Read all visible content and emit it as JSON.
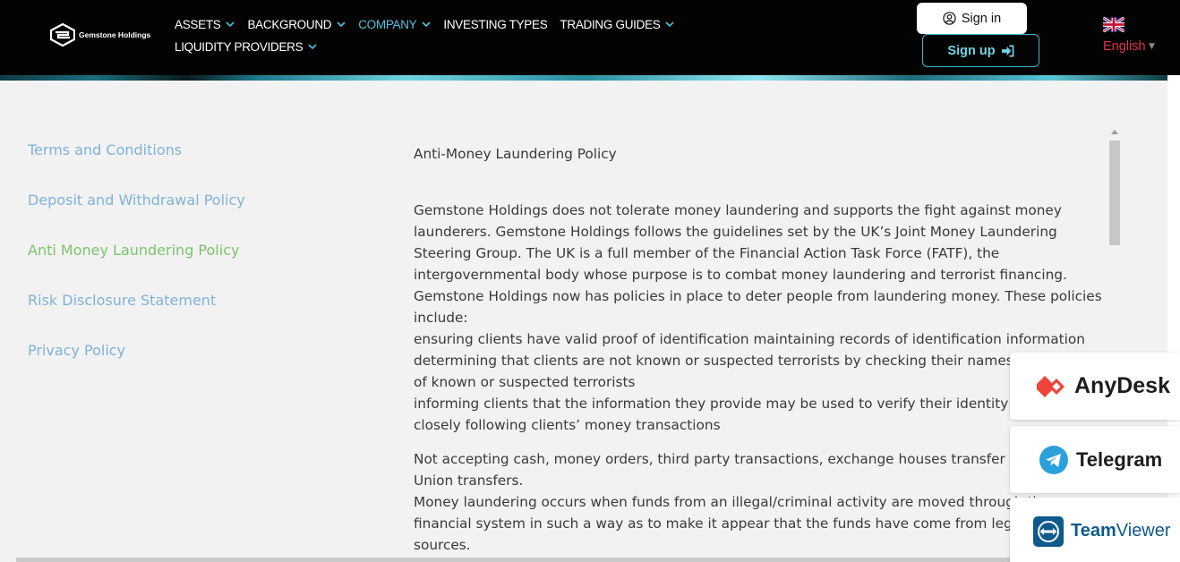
{
  "header": {
    "logo_text": "Gemstone Holdings",
    "nav_row1": [
      {
        "label": "ASSETS",
        "has_dropdown": true,
        "active": false
      },
      {
        "label": "BACKGROUND",
        "has_dropdown": true,
        "active": false
      },
      {
        "label": "COMPANY",
        "has_dropdown": true,
        "active": true
      },
      {
        "label": "INVESTING TYPES",
        "has_dropdown": false,
        "active": false
      },
      {
        "label": "TRADING GUIDES",
        "has_dropdown": true,
        "active": false
      }
    ],
    "nav_row2": [
      {
        "label": "LIQUIDITY PROVIDERS",
        "has_dropdown": true,
        "active": false
      }
    ],
    "signin_label": "Sign in",
    "signup_label": "Sign up",
    "language": "English"
  },
  "sidebar": {
    "items": [
      {
        "label": "Terms and Conditions",
        "active": false
      },
      {
        "label": "Deposit and Withdrawal Policy",
        "active": false
      },
      {
        "label": "Anti Money Laundering Policy",
        "active": true
      },
      {
        "label": "Risk Disclosure Statement",
        "active": false
      },
      {
        "label": "Privacy Policy",
        "active": false
      }
    ]
  },
  "article": {
    "title": "Anti-Money Laundering Policy",
    "para1": "Gemstone Holdings does not tolerate money laundering and supports the fight against money\nlaunderers. Gemstone Holdings follows the guidelines set by the UK’s Joint Money Laundering\nSteering Group. The UK is a full member of the Financial Action Task Force (FATF), the\nintergovernmental body whose purpose is to combat money laundering and terrorist financing.\nGemstone Holdings now has policies in place to deter people from laundering money. These policies\ninclude:\nensuring clients have valid proof of identification maintaining records of identification information\ndetermining that clients are not known or suspected terrorists by checking their names against lists\nof known or suspected terrorists\ninforming clients that the information they provide may be used to verify their identity\nclosely following clients’ money transactions",
    "para2": "Not accepting cash, money orders, third party transactions, exchange houses transfer or Western\nUnion transfers.\nMoney laundering occurs when funds from an illegal/criminal activity are moved through the\nfinancial system in such a way as to make it appear that the funds have come from legitimate\nsources."
  },
  "widgets": {
    "anydesk": "AnyDesk",
    "telegram": "Telegram",
    "teamviewer_bold": "Team",
    "teamviewer_light": "Viewer"
  },
  "colors": {
    "header_bg": "#030303",
    "nav_active": "#52c3dc",
    "sidebar_link": "#7fb3d7",
    "sidebar_active": "#7bc46c",
    "language": "#e0314b",
    "anydesk_red": "#ef443b",
    "telegram_blue": "#2aa1da",
    "teamviewer_blue": "#0e5a8a"
  }
}
